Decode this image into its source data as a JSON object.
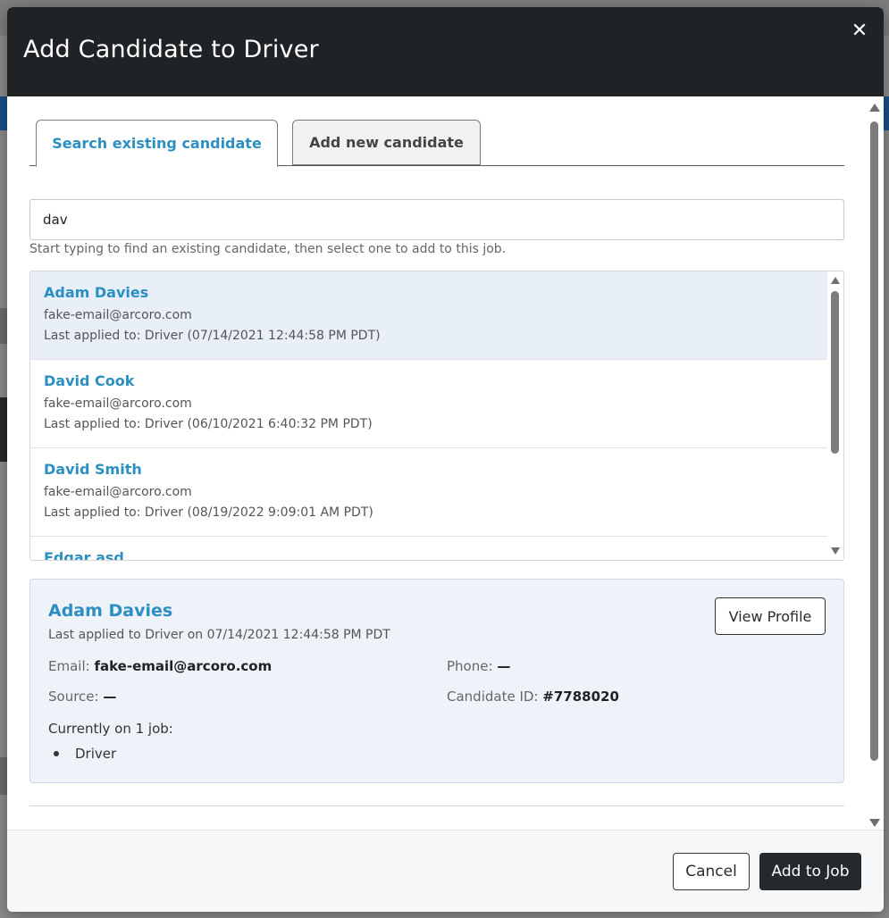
{
  "modal": {
    "title": "Add Candidate to Driver",
    "close_icon": "close-icon"
  },
  "tabs": [
    {
      "label": "Search existing candidate",
      "active": true
    },
    {
      "label": "Add new candidate",
      "active": false
    }
  ],
  "search": {
    "value": "dav",
    "hint": "Start typing to find an existing candidate, then select one to add to this job."
  },
  "results": [
    {
      "name": "Adam Davies",
      "email": "fake-email@arcoro.com",
      "applied": "Last applied to: Driver (07/14/2021 12:44:58 PM PDT)",
      "selected": true
    },
    {
      "name": "David Cook",
      "email": "fake-email@arcoro.com",
      "applied": "Last applied to: Driver (06/10/2021 6:40:32 PM PDT)",
      "selected": false
    },
    {
      "name": "David Smith",
      "email": "fake-email@arcoro.com",
      "applied": "Last applied to: Driver (08/19/2022 9:09:01 AM PDT)",
      "selected": false
    },
    {
      "name": "Edgar asd",
      "email": "",
      "applied": "",
      "selected": false
    }
  ],
  "detail": {
    "name": "Adam Davies",
    "subtitle": "Last applied to Driver on 07/14/2021 12:44:58 PM PDT",
    "view_profile_label": "View Profile",
    "email_label": "Email:",
    "email_value": "fake-email@arcoro.com",
    "phone_label": "Phone:",
    "phone_value": "—",
    "source_label": "Source:",
    "source_value": "—",
    "candidate_id_label": "Candidate ID:",
    "candidate_id_value": "#7788020",
    "jobs_label": "Currently on 1 job:",
    "jobs": [
      "Driver"
    ]
  },
  "footer": {
    "cancel_label": "Cancel",
    "add_label": "Add to Job"
  },
  "colors": {
    "header_bg": "#202326",
    "link_blue": "#2b8fc2",
    "selected_row": "#e8eff9",
    "detail_bg": "#eef3f9",
    "primary_button": "#25292d"
  }
}
